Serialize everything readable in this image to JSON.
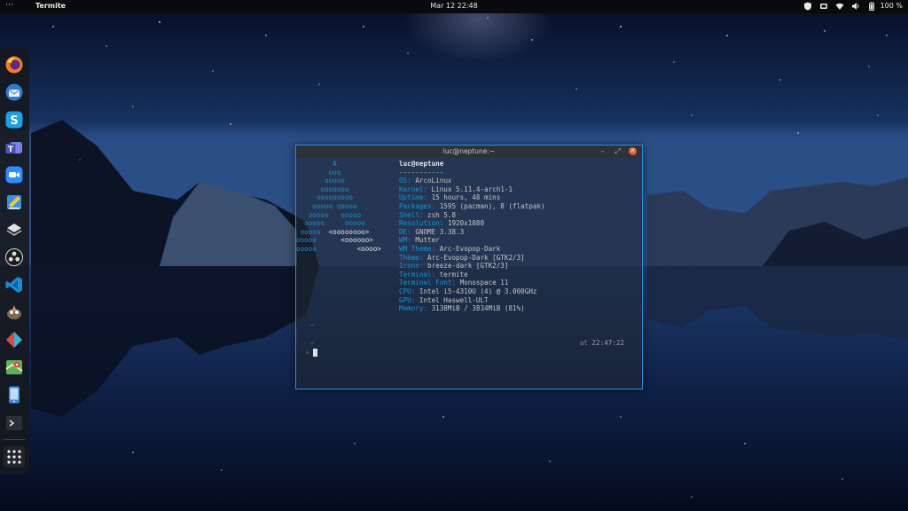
{
  "topbar": {
    "activities": "⋯",
    "app_name": "Termite",
    "clock": "Mar 12  22:48",
    "battery": "100 %",
    "tray_icons": [
      "shield-icon",
      "app-indicator-icon",
      "wifi-icon",
      "volume-icon",
      "battery-icon"
    ]
  },
  "dock": {
    "apps": [
      "firefox-icon",
      "thunderbird-icon",
      "skype-icon",
      "teams-icon",
      "zoom-icon",
      "text-editor-icon",
      "layers-icon",
      "obs-icon",
      "vscode-icon",
      "gimp-icon",
      "git-icon",
      "maps-icon",
      "phone-icon",
      "terminal-icon",
      "show-apps-icon"
    ]
  },
  "terminal": {
    "title": "luc@neptune:~",
    "buttons": {
      "minimize": "–",
      "maximize": "⤢",
      "close": "✕"
    },
    "logo_lines": [
      "         A",
      "        ooo",
      "       ooooo",
      "      ooooooo",
      "     ooooooooo",
      "    ooooo ooooo",
      "   ooooo   ooooo",
      "  ooooo     ooooo",
      " ooooo  <oooooooo>",
      "ooooo      <oooooo>",
      "ooooo          <oooo>"
    ],
    "user": "luc",
    "at": "@",
    "host": "neptune",
    "separator": "-----------",
    "info": [
      {
        "key": "OS",
        "value": "ArcoLinux"
      },
      {
        "key": "Kernel",
        "value": "Linux 5.11.4-arch1-1"
      },
      {
        "key": "Uptime",
        "value": "15 hours, 48 mins"
      },
      {
        "key": "Packages",
        "value": "1595 (pacman), 8 (flatpak)"
      },
      {
        "key": "Shell",
        "value": "zsh 5.8"
      },
      {
        "key": "Resolution",
        "value": "1920x1080"
      },
      {
        "key": "DE",
        "value": "GNOME 3.38.3"
      },
      {
        "key": "WM",
        "value": "Mutter"
      },
      {
        "key": "WM Theme",
        "value": "Arc-Evopop-Dark"
      },
      {
        "key": "Theme",
        "value": "Arc-Evopop-Dark [GTK2/3]"
      },
      {
        "key": "Icons",
        "value": "breeze-dark [GTK2/3]"
      },
      {
        "key": "Terminal",
        "value": "termite"
      },
      {
        "key": "Terminal Font",
        "value": "Monospace 11"
      },
      {
        "key": "CPU",
        "value": "Intel i5-4310U (4) @ 3.000GHz"
      },
      {
        "key": "GPU",
        "value": "Intel Haswell-ULT"
      },
      {
        "key": "Memory",
        "value": "3138MiB / 3834MiB (81%)"
      }
    ],
    "tilde_1": "~",
    "tilde_2": "~",
    "timestamp_prefix": "at",
    "timestamp": "22:47:22",
    "prompt_symbol": "›"
  }
}
